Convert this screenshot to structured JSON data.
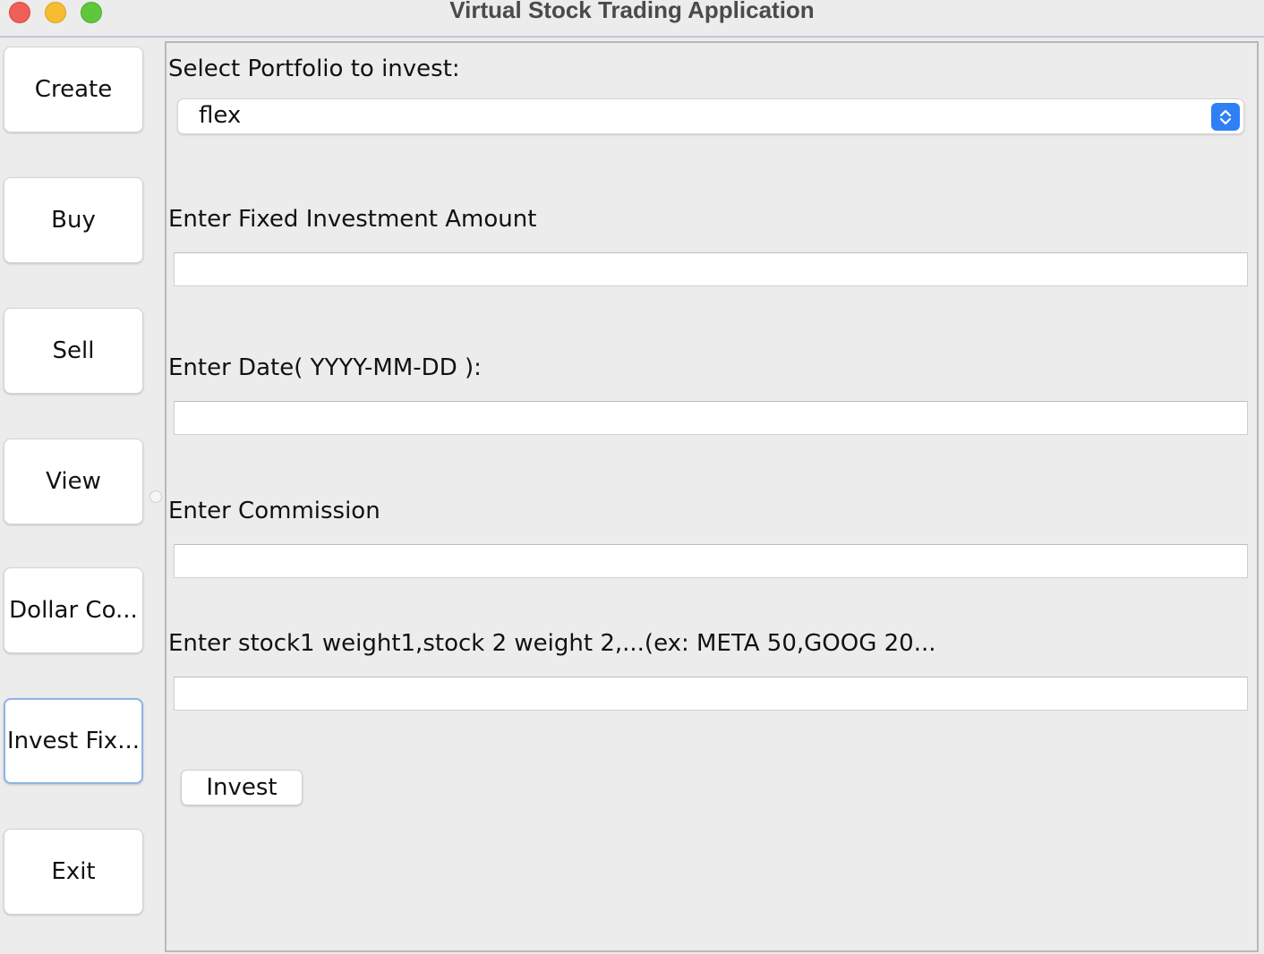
{
  "window": {
    "title": "Virtual Stock Trading Application"
  },
  "sidebar": {
    "items": [
      {
        "label": "Create"
      },
      {
        "label": "Buy"
      },
      {
        "label": "Sell"
      },
      {
        "label": "View"
      },
      {
        "label": "Dollar Co..."
      },
      {
        "label": "Invest Fix...",
        "selected": true
      },
      {
        "label": "Exit"
      }
    ]
  },
  "form": {
    "portfolio_label": "Select Portfolio to invest:",
    "portfolio_selected": "flex",
    "amount_label": "Enter Fixed Investment Amount",
    "amount_value": "",
    "date_label": "Enter Date( YYYY-MM-DD ):",
    "date_value": "",
    "commission_label": "Enter Commission",
    "commission_value": "",
    "weights_label": "Enter stock1 weight1,stock 2 weight 2,...(ex: META 50,GOOG 20...",
    "weights_value": "",
    "invest_label": "Invest"
  },
  "colors": {
    "accent": "#2f7ff5",
    "selected_border": "#8fb4e6",
    "close": "#ee5f57",
    "minimize": "#f5bd2f",
    "maximize": "#5fc73c"
  }
}
